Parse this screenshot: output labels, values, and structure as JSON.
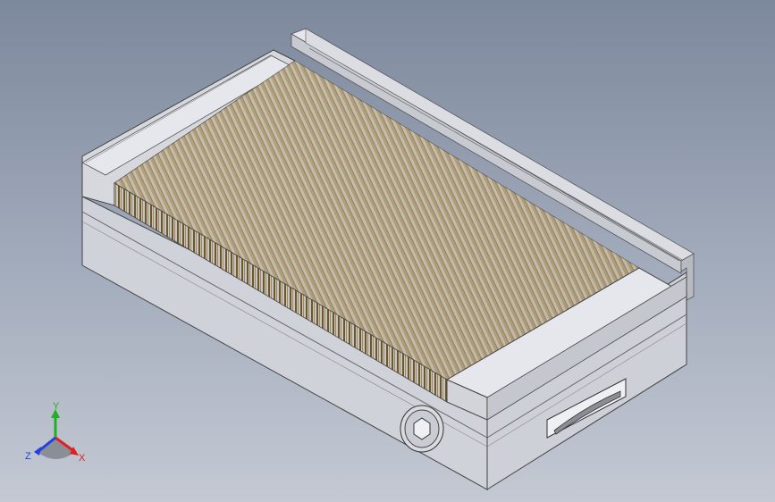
{
  "viewport": {
    "model": "magnetic-chuck",
    "background_top": "#7c889c",
    "background_bottom": "#c4c9d3"
  },
  "triad": {
    "x_label": "X",
    "y_label": "Y",
    "z_label": "Z",
    "x_color": "#e02020",
    "y_color": "#22b022",
    "z_color": "#2040e0"
  },
  "colors": {
    "body_light": "#d2d4da",
    "body_mid": "#c3c6cc",
    "end_plate_top": "#e4e5ec",
    "pole_brass": "#b49a72",
    "pole_steel": "#cfd0d4"
  }
}
